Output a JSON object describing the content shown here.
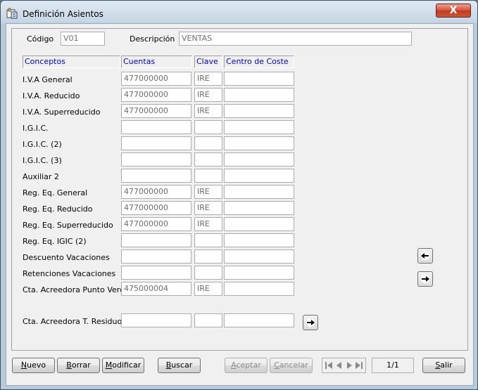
{
  "window": {
    "title": "Definición Asientos",
    "close_label": "X"
  },
  "header": {
    "codigo_label": "Código",
    "codigo_value": "V01",
    "descripcion_label": "Descripción",
    "descripcion_value": "VENTAS"
  },
  "columns": [
    "Conceptos",
    "Cuentas",
    "Clave",
    "Centro de Coste"
  ],
  "rows": [
    {
      "concepto": "I.V.A General",
      "cuenta": "477000000",
      "clave": "IRE",
      "centro": ""
    },
    {
      "concepto": "I.V.A. Reducido",
      "cuenta": "477000000",
      "clave": "IRE",
      "centro": ""
    },
    {
      "concepto": "I.V.A. Superreducido",
      "cuenta": "477000000",
      "clave": "IRE",
      "centro": ""
    },
    {
      "concepto": "I.G.I.C.",
      "cuenta": "",
      "clave": "",
      "centro": ""
    },
    {
      "concepto": "I.G.I.C. (2)",
      "cuenta": "",
      "clave": "",
      "centro": ""
    },
    {
      "concepto": "I.G.I.C. (3)",
      "cuenta": "",
      "clave": "",
      "centro": ""
    },
    {
      "concepto": "Auxiliar 2",
      "cuenta": "",
      "clave": "",
      "centro": ""
    },
    {
      "concepto": "Reg. Eq. General",
      "cuenta": "477000000",
      "clave": "IRE",
      "centro": ""
    },
    {
      "concepto": "Reg. Eq. Reducido",
      "cuenta": "477000000",
      "clave": "IRE",
      "centro": ""
    },
    {
      "concepto": "Reg. Eq. Superreducido",
      "cuenta": "477000000",
      "clave": "IRE",
      "centro": ""
    },
    {
      "concepto": "Reg. Eq. IGIC (2)",
      "cuenta": "",
      "clave": "",
      "centro": ""
    },
    {
      "concepto": "Descuento Vacaciones",
      "cuenta": "",
      "clave": "",
      "centro": ""
    },
    {
      "concepto": "Retenciones Vacaciones",
      "cuenta": "",
      "clave": "",
      "centro": ""
    },
    {
      "concepto": "Cta. Acreedora Punto Verde",
      "cuenta": "475000004",
      "clave": "IRE",
      "centro": ""
    }
  ],
  "residuos": {
    "concepto": "Cta. Acreedora T. Residuos",
    "cuenta": "",
    "clave": "",
    "centro": ""
  },
  "buttons": {
    "nuevo": {
      "underline": "N",
      "rest": "uevo"
    },
    "borrar": {
      "underline": "B",
      "rest": "orrar"
    },
    "modificar": {
      "underline": "M",
      "rest": "odificar"
    },
    "buscar": {
      "underline": "B",
      "rest": "uscar"
    },
    "aceptar": {
      "underline": "A",
      "rest": "ceptar"
    },
    "cancelar": {
      "underline": "C",
      "rest": "ancelar"
    },
    "salir": {
      "underline": "S",
      "rest": "alir"
    }
  },
  "pagination": {
    "page": "1/1"
  },
  "colors": {
    "header_text": "#0000c8",
    "field_text": "#6d6d6d",
    "close_red": "#c13a21"
  }
}
